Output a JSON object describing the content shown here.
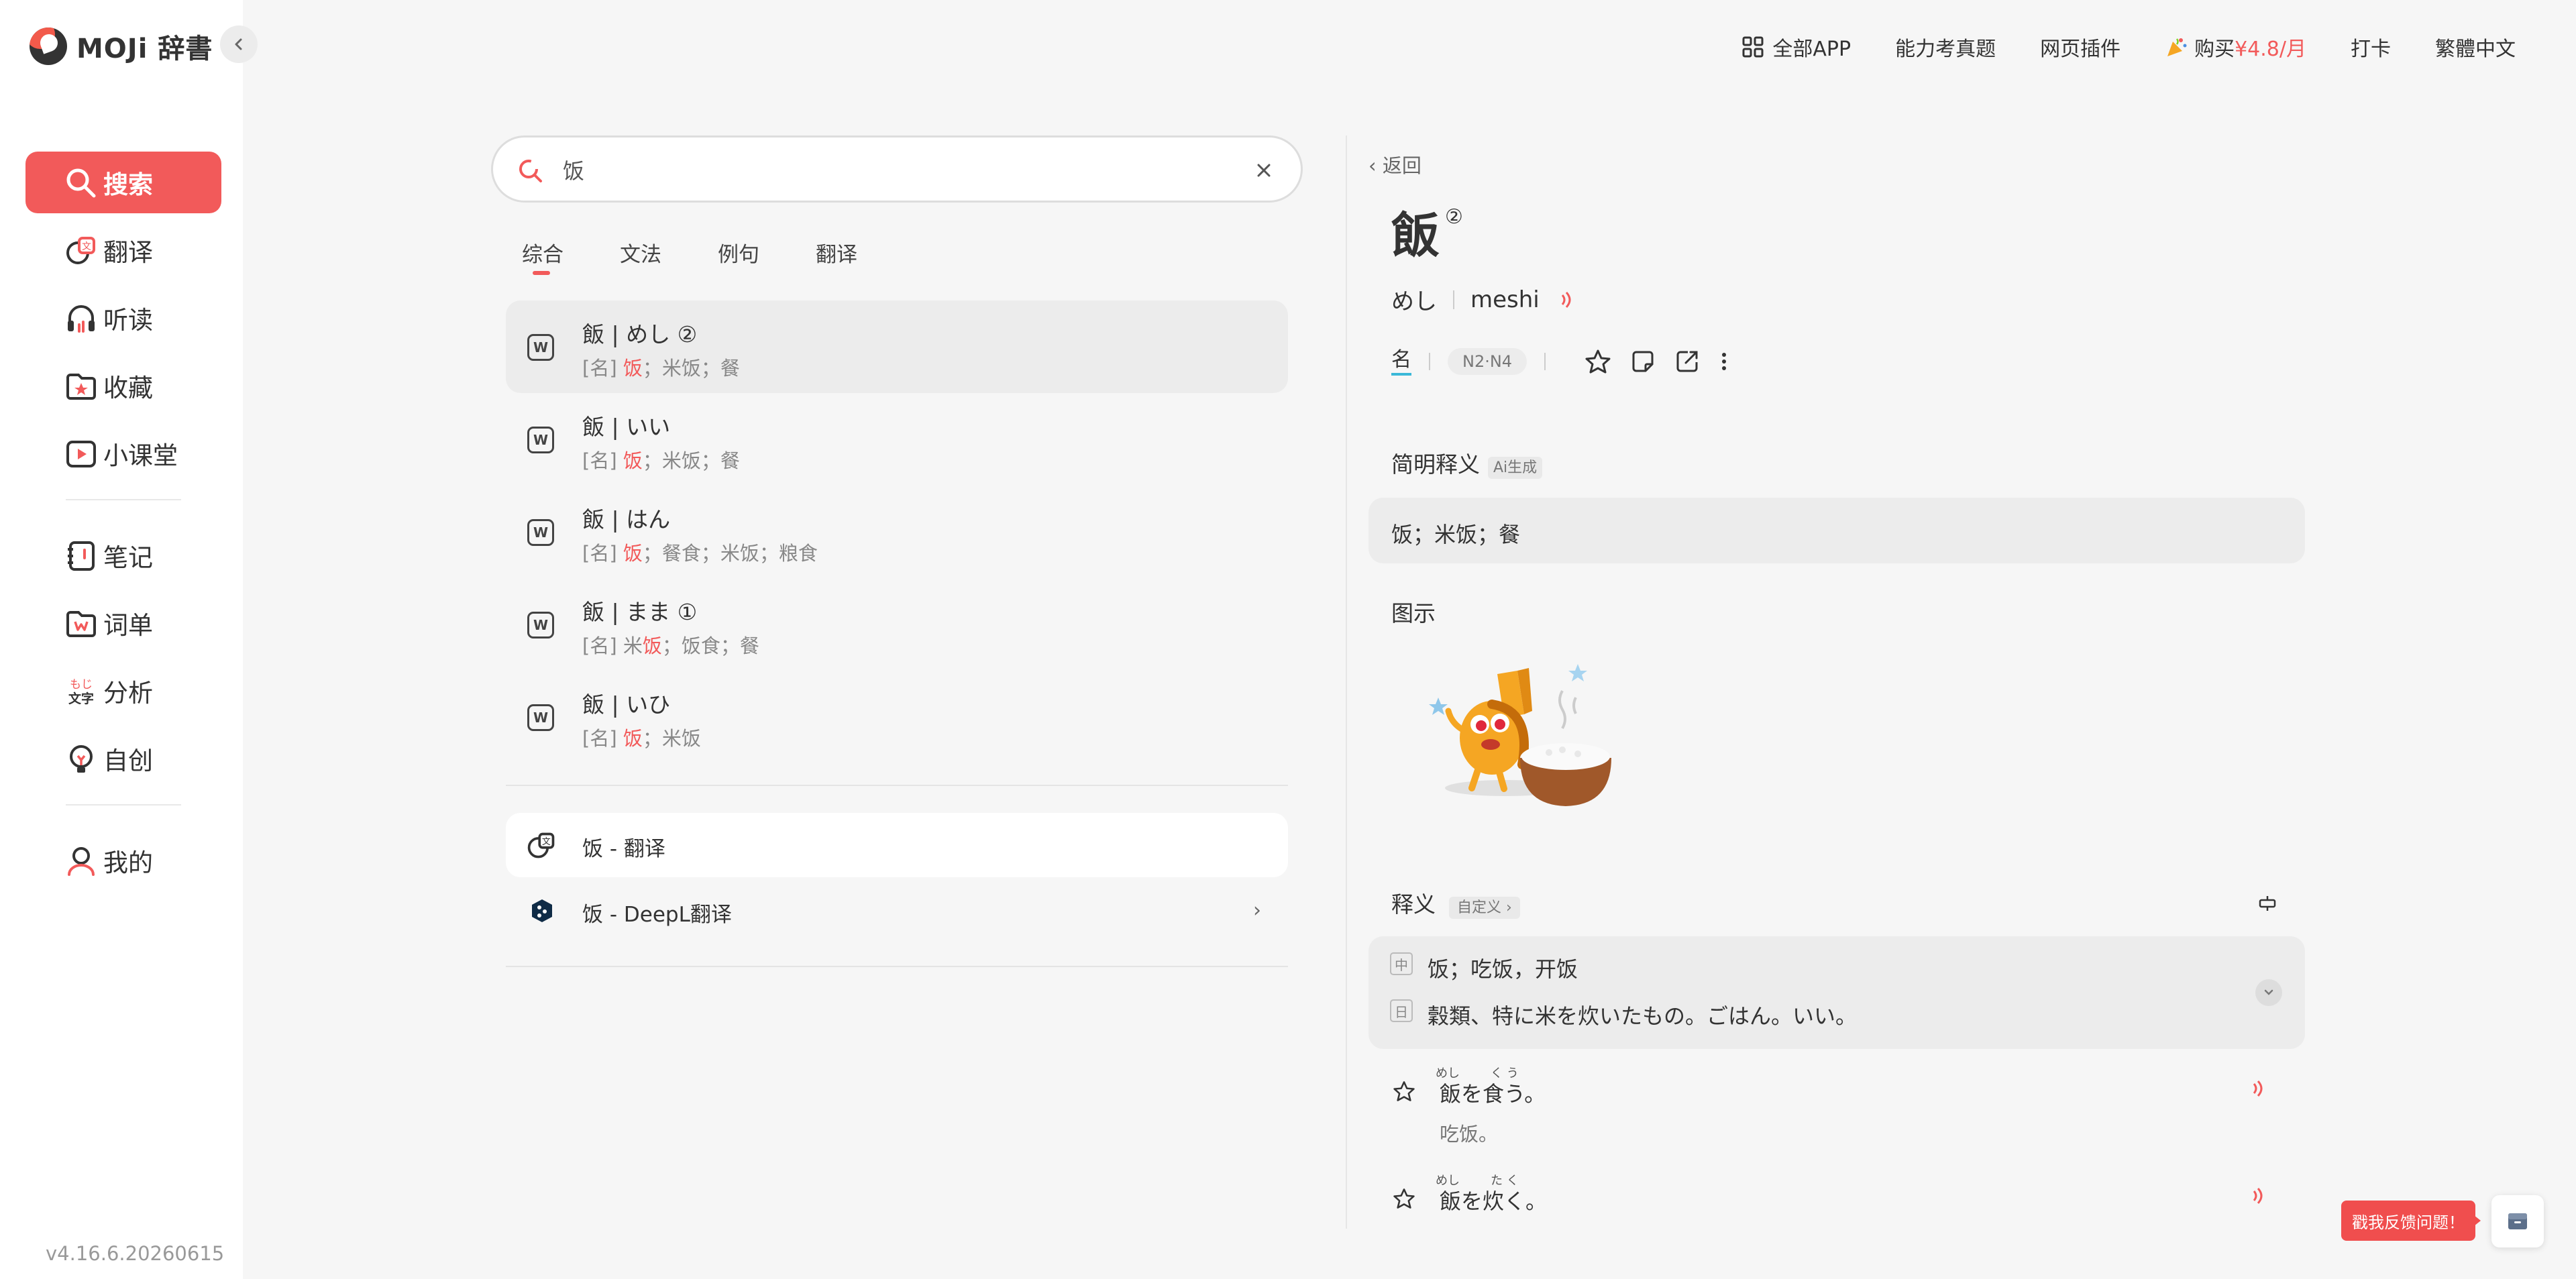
{
  "app": {
    "logo_text": "MOJi 辞書",
    "version": "v4.16.6.20260615"
  },
  "sidebar": {
    "items": [
      {
        "label": "搜索",
        "icon": "search-icon"
      },
      {
        "label": "翻译",
        "icon": "translate-icon"
      },
      {
        "label": "听读",
        "icon": "headphones-icon"
      },
      {
        "label": "收藏",
        "icon": "folder-star-icon"
      },
      {
        "label": "小课堂",
        "icon": "play-icon"
      },
      {
        "label": "笔记",
        "icon": "notebook-icon"
      },
      {
        "label": "词单",
        "icon": "wordlist-icon"
      },
      {
        "label": "分析",
        "icon": "analysis-icon"
      },
      {
        "label": "自创",
        "icon": "bulb-icon"
      },
      {
        "label": "我的",
        "icon": "user-icon"
      }
    ],
    "analysis_icon_text": [
      "もじ",
      "文字"
    ]
  },
  "topbar": {
    "all_app": "全部APP",
    "exam": "能力考真题",
    "plugin": "网页插件",
    "buy_prefix": "购买",
    "buy_price": "¥4.8/月",
    "checkin": "打卡",
    "traditional": "繁體中文"
  },
  "search": {
    "value": "饭",
    "placeholder": ""
  },
  "tabs": [
    "综合",
    "文法",
    "例句",
    "翻译"
  ],
  "results": [
    {
      "title": "飯 | めし ②",
      "pos": "[名]",
      "hl": "饭",
      "rest": "；米饭；餐",
      "pre": ""
    },
    {
      "title": "飯 | いい",
      "pos": "[名]",
      "hl": "饭",
      "rest": "；米饭；餐",
      "pre": ""
    },
    {
      "title": "飯 | はん",
      "pos": "[名]",
      "hl": "饭",
      "rest": "；餐食；米饭；粮食",
      "pre": ""
    },
    {
      "title": "飯 | まま ①",
      "pos": "[名]",
      "hl": "饭",
      "rest": "；饭食；餐",
      "pre": "米"
    },
    {
      "title": "飯 | いひ",
      "pos": "[名]",
      "hl": "饭",
      "rest": "；米饭",
      "pre": ""
    }
  ],
  "translate": {
    "item1": "饭 - 翻译",
    "item2": "饭 - DeepL翻译"
  },
  "detail": {
    "back": "返回",
    "word": "飯",
    "tone": "②",
    "kana": "めし",
    "romaji": "meshi",
    "pos": "名",
    "level": "N2·N4",
    "brief_label": "简明释义",
    "ai_badge": "Ai生成",
    "brief": "饭；米饭；餐",
    "illust_label": "图示",
    "meaning_label": "释义",
    "custom_badge": "自定义",
    "zh_tag": "中",
    "jp_tag": "日",
    "zh_meaning": "饭；吃饭，开饭",
    "jp_meaning": "穀類、特に米を炊いたもの。ごはん。いい。",
    "examples": [
      {
        "jp": "飯を食う。",
        "furi1": "めし",
        "furi2": "く う",
        "zh": "吃饭。"
      },
      {
        "jp": "飯を炊く。",
        "furi1": "めし",
        "furi2": "た く",
        "zh": ""
      }
    ]
  },
  "feedback": "戳我反馈问题！",
  "colors": {
    "accent": "#f25a5a",
    "sidebar_bg": "#ffffff",
    "page_bg": "#f6f6f6",
    "pos_underline": "#3bb8d8"
  }
}
